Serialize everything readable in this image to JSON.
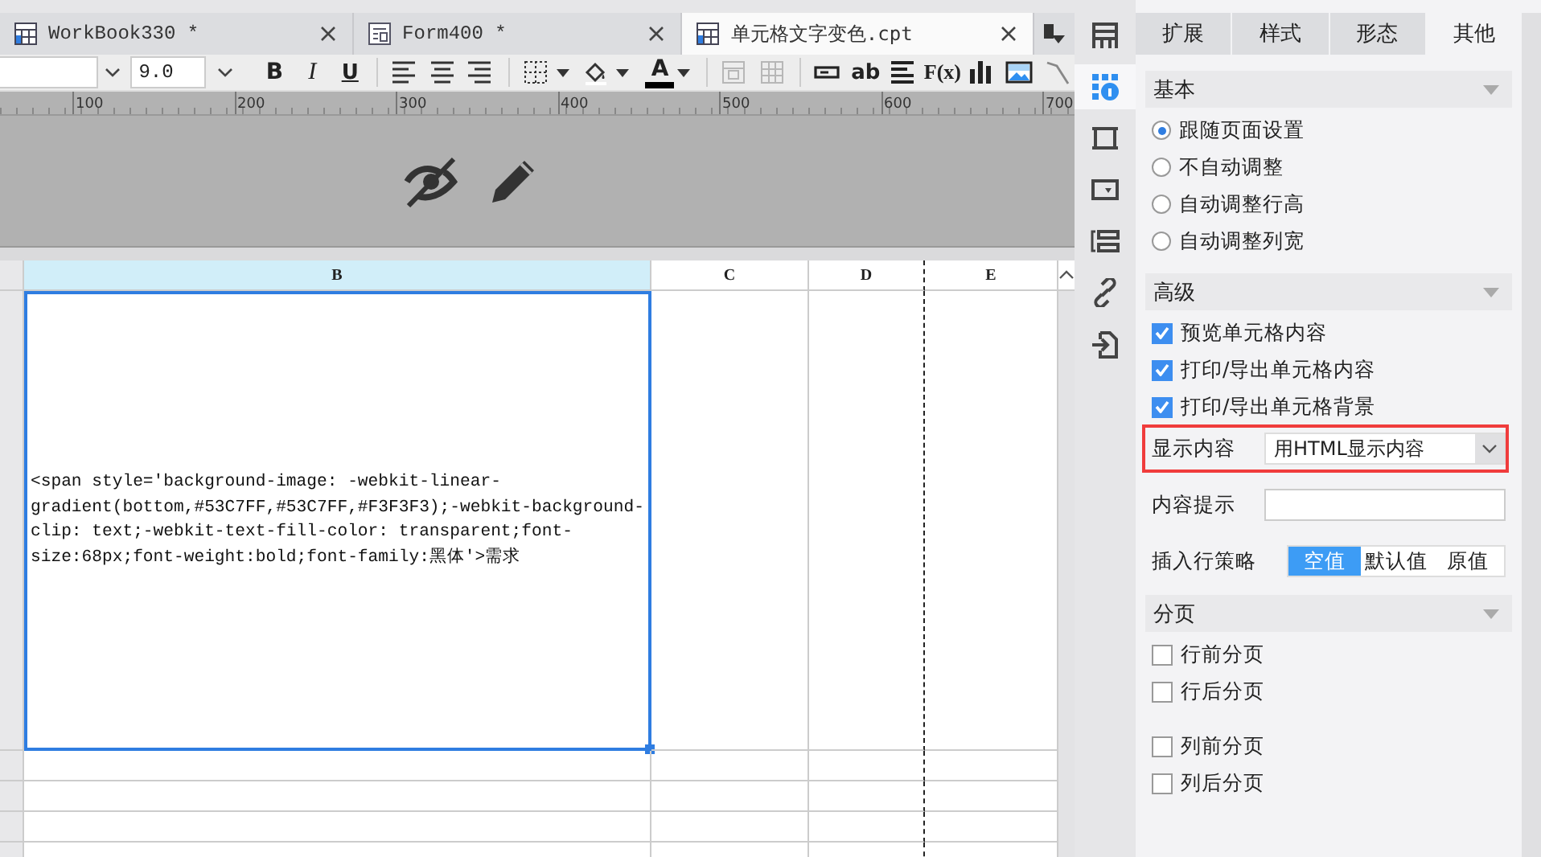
{
  "tabs": [
    {
      "label": "WorkBook330 *",
      "kind": "workbook",
      "selected": false
    },
    {
      "label": "Form400 *",
      "kind": "form",
      "selected": false
    },
    {
      "label": "单元格文字变色.cpt",
      "kind": "workbook",
      "selected": true
    }
  ],
  "toolbar": {
    "font_size": "9.0",
    "items": [
      {
        "kind": "bold",
        "label": "B"
      },
      {
        "kind": "italic",
        "label": "I"
      },
      {
        "kind": "underline",
        "label": "U"
      },
      {
        "kind": "sep"
      },
      {
        "kind": "align-left"
      },
      {
        "kind": "align-center"
      },
      {
        "kind": "align-right"
      },
      {
        "kind": "sep"
      },
      {
        "kind": "border"
      },
      {
        "kind": "fill"
      },
      {
        "kind": "font-color",
        "label": "A"
      },
      {
        "kind": "sep"
      },
      {
        "kind": "merge",
        "disabled": true
      },
      {
        "kind": "unmerge",
        "disabled": true
      },
      {
        "kind": "sep"
      },
      {
        "kind": "textfield"
      },
      {
        "kind": "text",
        "label": "ab"
      },
      {
        "kind": "richtext"
      },
      {
        "kind": "formula",
        "label": "F(x)"
      },
      {
        "kind": "chart"
      },
      {
        "kind": "image"
      },
      {
        "kind": "slash"
      }
    ]
  },
  "ruler": {
    "ticks": [
      "100",
      "200",
      "300",
      "400",
      "500",
      "600",
      "700"
    ]
  },
  "grid": {
    "columns": [
      {
        "label": "B",
        "selected": true
      },
      {
        "label": "C",
        "selected": false
      },
      {
        "label": "D",
        "selected": false
      },
      {
        "label": "E",
        "selected": false
      }
    ],
    "cell_text": "<span style='background-image: -webkit-linear-gradient(bottom,#53C7FF,#53C7FF,#F3F3F3);-webkit-background-clip: text;-webkit-text-fill-color: transparent;font-size:68px;font-weight:bold;font-family:黑体'>需求"
  },
  "side_icons": [
    {
      "kind": "cell",
      "selected": false
    },
    {
      "kind": "attributes",
      "selected": true
    },
    {
      "kind": "frame",
      "selected": false
    },
    {
      "kind": "widget",
      "selected": false
    },
    {
      "kind": "condition",
      "selected": false
    },
    {
      "kind": "link",
      "selected": false
    },
    {
      "kind": "import",
      "selected": false
    }
  ],
  "panel": {
    "tabs": [
      {
        "label": "扩展",
        "selected": false
      },
      {
        "label": "样式",
        "selected": false
      },
      {
        "label": "形态",
        "selected": false
      },
      {
        "label": "其他",
        "selected": true
      }
    ],
    "sections": [
      {
        "title": "基本",
        "groups": [
          [
            {
              "kind": "radio",
              "label": "跟随页面设置",
              "checked": true
            },
            {
              "kind": "radio",
              "label": "不自动调整",
              "checked": false
            },
            {
              "kind": "radio",
              "label": "自动调整行高",
              "checked": false
            },
            {
              "kind": "radio",
              "label": "自动调整列宽",
              "checked": false
            }
          ]
        ]
      },
      {
        "title": "高级",
        "groups": [
          [
            {
              "kind": "checkbox",
              "label": "预览单元格内容",
              "checked": true
            },
            {
              "kind": "checkbox",
              "label": "打印/导出单元格内容",
              "checked": true
            },
            {
              "kind": "checkbox",
              "label": "打印/导出单元格背景",
              "checked": true
            },
            {
              "kind": "select",
              "label": "显示内容",
              "value": "用HTML显示内容",
              "highlighted": true
            },
            {
              "kind": "text",
              "label": "内容提示"
            },
            {
              "kind": "segmented",
              "label": "插入行策略",
              "options": [
                {
                  "label": "空值",
                  "selected": true
                },
                {
                  "label": "默认值",
                  "selected": false
                },
                {
                  "label": "原值",
                  "selected": false
                }
              ]
            }
          ]
        ]
      },
      {
        "title": "分页",
        "groups": [
          [
            {
              "kind": "checkbox",
              "label": "行前分页",
              "checked": false
            },
            {
              "kind": "checkbox",
              "label": "行后分页",
              "checked": false
            }
          ],
          [
            {
              "kind": "checkbox",
              "label": "列前分页",
              "checked": false
            },
            {
              "kind": "checkbox",
              "label": "列后分页",
              "checked": false
            }
          ]
        ]
      }
    ]
  }
}
